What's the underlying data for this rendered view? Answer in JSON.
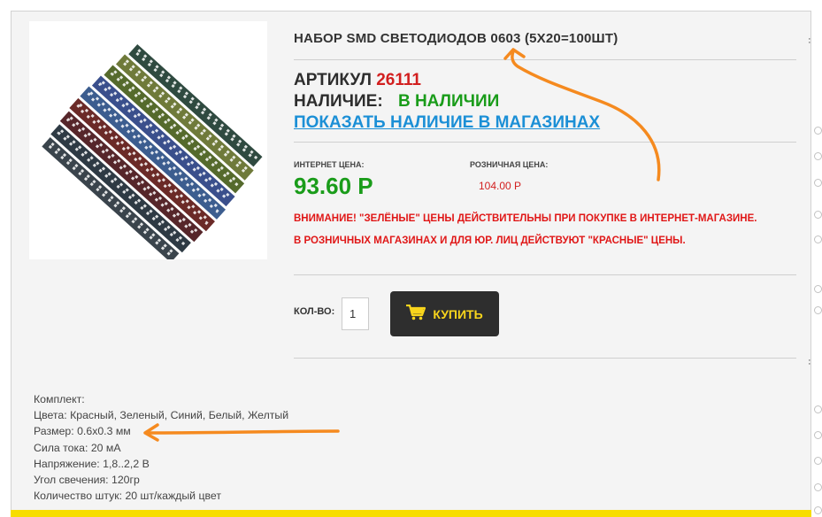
{
  "product": {
    "title": "НАБОР SMD СВЕТОДИОДОВ 0603 (5X20=100ШТ)",
    "sku_label": "АРТИКУЛ",
    "sku_value": "26111",
    "availability_label": "НАЛИЧИЕ:",
    "availability_value": "В НАЛИЧИИ",
    "stores_link": "ПОКАЗАТЬ НАЛИЧИЕ В МАГАЗИНАХ",
    "image_alt": "SMD LED strips"
  },
  "prices": {
    "internet_label": "ИНТЕРНЕТ ЦЕНА:",
    "internet_value": "93.60 Р",
    "retail_label": "РОЗНИЧНАЯ ЦЕНА:",
    "retail_value": "104.00 Р"
  },
  "notice": {
    "line1": "ВНИМАНИЕ! \"ЗЕЛЁНЫЕ\" ЦЕНЫ ДЕЙСТВИТЕЛЬНЫ ПРИ ПОКУПКЕ В ИНТЕРНЕТ-МАГАЗИНЕ.",
    "line2": "В РОЗНИЧНЫХ МАГАЗИНАХ И ДЛЯ ЮР. ЛИЦ ДЕЙСТВУЮТ \"КРАСНЫЕ\" ЦЕНЫ."
  },
  "purchase": {
    "qty_label": "КОЛ-ВО:",
    "qty_value": "1",
    "buy_label": "КУПИТЬ",
    "buy_icon": "shopping-cart-icon"
  },
  "specs": [
    "Комплект:",
    "Цвета: Красный, Зеленый, Синий, Белый, Желтый",
    "Размер: 0.6x0.3 мм",
    "Сила тока: 20 мА",
    "Напряжение: 1,8..2,2 В",
    "Угол свечения: 120гр",
    "Количество штук: 20 шт/каждый цвет"
  ],
  "colors": {
    "price_green": "#1a9c1a",
    "price_red": "#d21f1f",
    "link_blue": "#1b8fd6",
    "buy_bg": "#2e2e2e",
    "buy_text": "#f9d51c",
    "annotation_orange": "#f58a1f"
  }
}
